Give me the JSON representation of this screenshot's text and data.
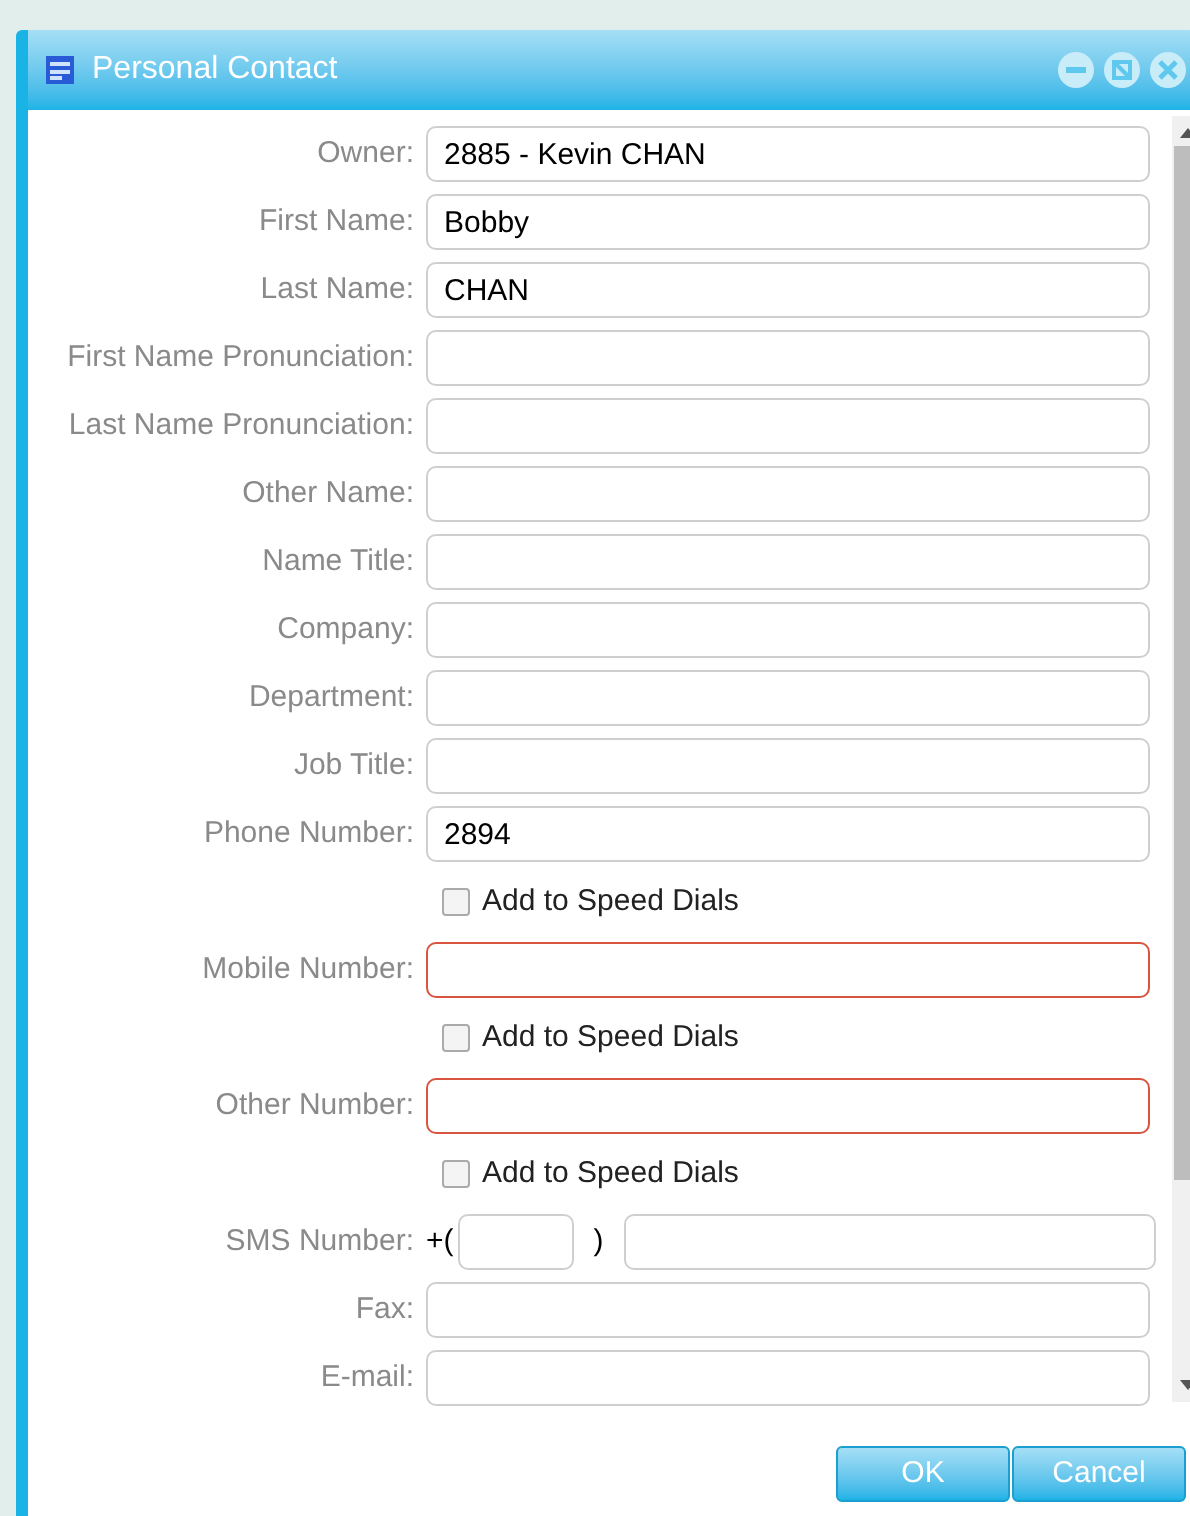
{
  "window": {
    "title": "Personal Contact"
  },
  "rows": [
    {
      "kind": "field",
      "label": "Owner:",
      "value": "2885 - Kevin CHAN",
      "invalid": false
    },
    {
      "kind": "field",
      "label": "First Name:",
      "value": "Bobby",
      "invalid": false
    },
    {
      "kind": "field",
      "label": "Last Name:",
      "value": "CHAN",
      "invalid": false
    },
    {
      "kind": "field",
      "label": "First Name Pronunciation:",
      "invalid": false
    },
    {
      "kind": "field",
      "label": "Last Name Pronunciation:",
      "invalid": false
    },
    {
      "kind": "field",
      "label": "Other Name:",
      "invalid": false
    },
    {
      "kind": "field",
      "label": "Name Title:",
      "invalid": false
    },
    {
      "kind": "field",
      "label": "Company:",
      "invalid": false
    },
    {
      "kind": "field",
      "label": "Department:",
      "invalid": false
    },
    {
      "kind": "field",
      "label": "Job Title:",
      "invalid": false
    },
    {
      "kind": "field",
      "label": "Phone Number:",
      "value": "2894",
      "invalid": false
    },
    {
      "kind": "checkbox",
      "label": "Add to Speed Dials",
      "checked": false
    },
    {
      "kind": "field",
      "label": "Mobile Number:",
      "invalid": true
    },
    {
      "kind": "checkbox",
      "label": "Add to Speed Dials",
      "checked": false
    },
    {
      "kind": "field",
      "label": "Other Number:",
      "invalid": true
    },
    {
      "kind": "checkbox",
      "label": "Add to Speed Dials",
      "checked": false
    },
    {
      "kind": "sms",
      "label": "SMS Number:",
      "prefix": "+(",
      "close": ")"
    },
    {
      "kind": "field",
      "label": "Fax:",
      "invalid": false
    },
    {
      "kind": "field",
      "label": "E-mail:",
      "invalid": false
    }
  ],
  "buttons": [
    "OK",
    "Cancel"
  ]
}
